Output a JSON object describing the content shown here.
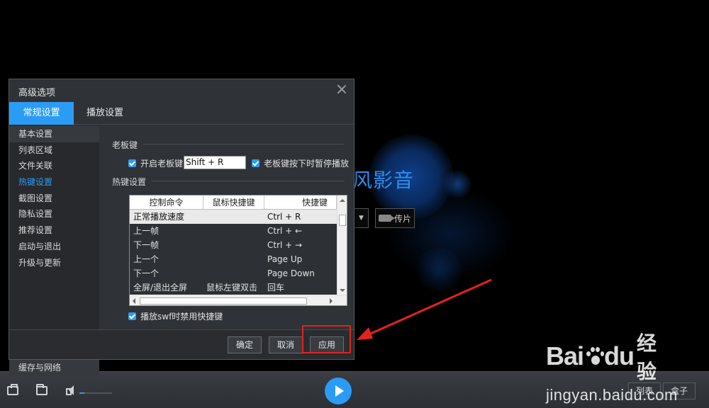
{
  "background": {
    "app_name_partial": "风影音",
    "upload_label": "传片"
  },
  "dialog": {
    "title": "高级选项",
    "tabs": [
      "常规设置",
      "播放设置"
    ],
    "sidebar": {
      "items": [
        "基本设置",
        "列表区域",
        "文件关联",
        "热键设置",
        "截图设置",
        "隐私设置",
        "推荐设置",
        "启动与退出",
        "升级与更新"
      ],
      "bottom_item": "缓存与网络"
    },
    "boss_key": {
      "section_title": "老板键",
      "enable_label": "开启老板键",
      "enable_checked": true,
      "key_value": "Shift + R",
      "pause_label": "老板键按下时暂停播放",
      "pause_checked": true
    },
    "hotkeys": {
      "section_title": "热键设置",
      "columns": [
        "控制命令",
        "鼠标快捷键",
        "快捷键"
      ],
      "rows": [
        {
          "command": "正常播放速度",
          "mouse": "",
          "key": "Ctrl + R"
        },
        {
          "command": "上一帧",
          "mouse": "",
          "key": "Ctrl + ←"
        },
        {
          "command": "下一帧",
          "mouse": "",
          "key": "Ctrl + →"
        },
        {
          "command": "上一个",
          "mouse": "",
          "key": "Page Up"
        },
        {
          "command": "下一个",
          "mouse": "",
          "key": "Page Down"
        },
        {
          "command": "全屏/退出全屏",
          "mouse": "鼠标左键双击",
          "key": "回车"
        }
      ],
      "swf_label": "播放swf时禁用快捷键",
      "swf_checked": true
    },
    "buttons": {
      "ok": "确定",
      "cancel": "取消",
      "apply": "应用"
    }
  },
  "control_bar": {
    "list_label": "列表",
    "box_label": "盒子",
    "volume": 0.15
  },
  "watermark": {
    "brand_cn": "经验",
    "url": "jingyan.baidu.com"
  },
  "colors": {
    "accent": "#2b9cf5",
    "highlight_box": "#e0241c"
  }
}
